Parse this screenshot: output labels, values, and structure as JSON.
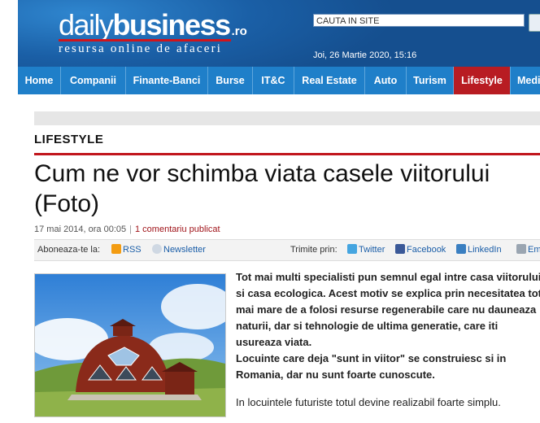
{
  "header": {
    "logo_daily": "daily",
    "logo_business": "business",
    "logo_tld": ".ro",
    "tagline": "resursa online de afaceri",
    "search_value": "CAUTA IN SITE",
    "date": "Joi, 26 Martie 2020, 15:16"
  },
  "nav": {
    "items": [
      "Home",
      "Companii",
      "Finante-Banci",
      "Burse",
      "IT&C",
      "Real Estate",
      "Auto",
      "Turism",
      "Lifestyle",
      "Medi"
    ]
  },
  "article": {
    "section": "LIFESTYLE",
    "title": "Cum ne vor schimba viata casele viitorului (Foto)",
    "date": "17 mai 2014, ora 00:05",
    "separator": "|",
    "comments": "1 comentariu publicat",
    "paragraph1": "Tot mai multi specialisti pun semnul egal intre casa viitorului si casa ecologica. Acest motiv se explica prin necesitatea tot mai mare de a folosi resurse regenerabile care nu dauneaza naturii, dar si tehnologie de ultima generatie, care iti usureaza viata.",
    "paragraph2": "Locuinte care deja \"sunt in viitor\" se construiesc si in Romania, dar nu sunt foarte cunoscute.",
    "paragraph3": "In locuintele futuriste totul devine realizabil foarte simplu."
  },
  "share": {
    "subscribe_label": "Aboneaza-te la:",
    "rss": "RSS",
    "newsletter": "Newsletter",
    "send_label": "Trimite prin:",
    "twitter": "Twitter",
    "facebook": "Facebook",
    "linkedin": "LinkedIn",
    "email": "Email"
  },
  "colors": {
    "header_blue": "#1a5fa6",
    "nav_blue": "#1f7fc9",
    "accent_red": "#c1161d"
  }
}
